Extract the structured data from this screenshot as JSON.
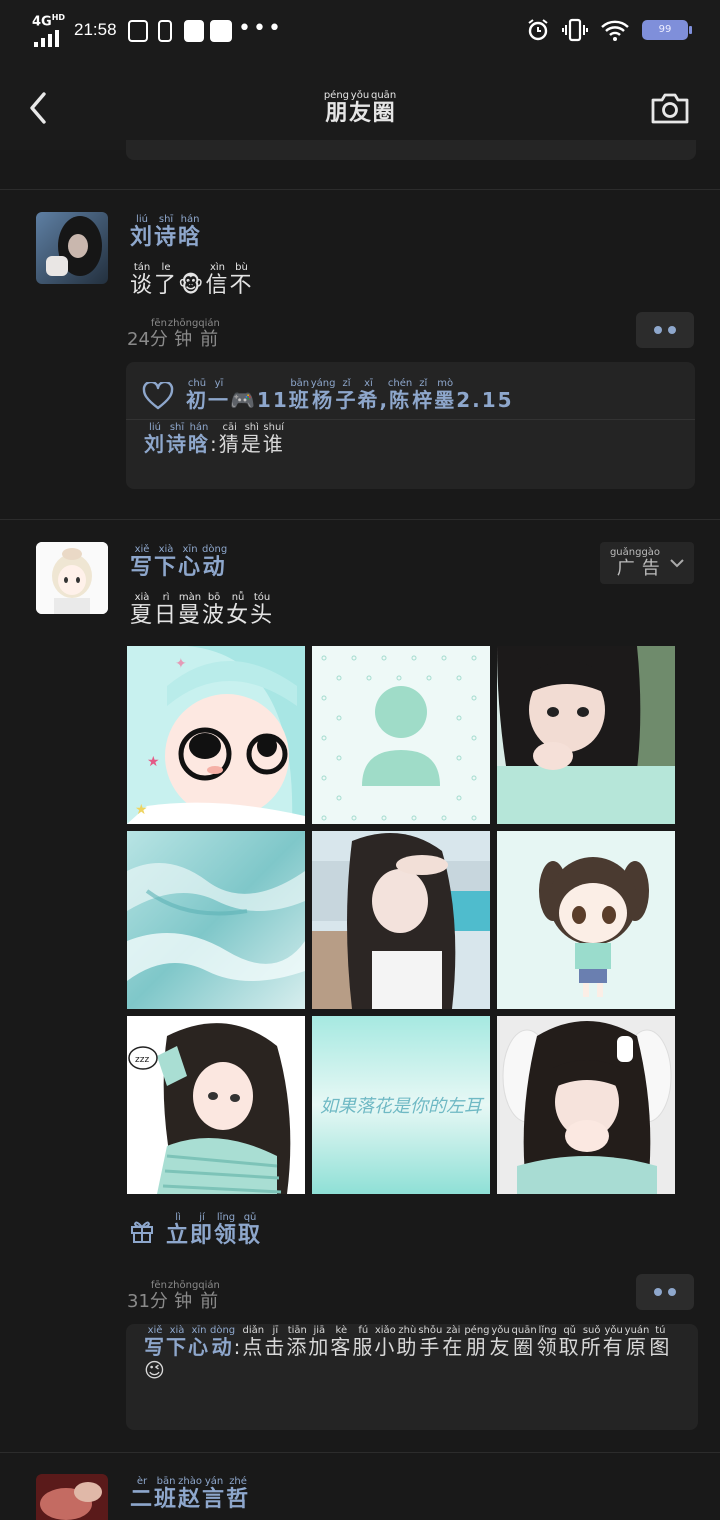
{
  "status_bar": {
    "network": "4G",
    "network_sup": "HD",
    "time": "21:58",
    "battery_label": "99",
    "accent_color": "#7f8fda"
  },
  "nav": {
    "title": [
      [
        "朋",
        "péng"
      ],
      [
        "友",
        "yǒu"
      ],
      [
        "圈",
        "quān"
      ]
    ],
    "back_icon": "chevron-left-icon",
    "camera_icon": "camera-icon"
  },
  "posts": [
    {
      "author": [
        [
          "刘",
          "liú"
        ],
        [
          "诗",
          "shī"
        ],
        [
          "晗",
          "hán"
        ]
      ],
      "text": [
        [
          "谈",
          "tán"
        ],
        [
          "了",
          "le"
        ],
        [
          "🐵",
          ""
        ],
        [
          "信",
          "xìn"
        ],
        [
          "不",
          "bù"
        ]
      ],
      "time_num": "24",
      "time_text": [
        [
          "分",
          "fēn"
        ],
        [
          "钟",
          "zhōng"
        ],
        [
          "前",
          "qián"
        ]
      ],
      "likes": {
        "names": [
          [
            "初",
            "chū"
          ],
          [
            "一",
            "yī"
          ],
          [
            "🎮",
            ""
          ],
          [
            "11",
            ""
          ],
          [
            "班",
            "bān"
          ],
          [
            "杨",
            "yáng"
          ],
          [
            "子",
            "zǐ"
          ],
          [
            "希",
            "xī"
          ],
          [
            ",",
            ""
          ],
          [
            "陈",
            "chén"
          ],
          [
            "梓",
            "zǐ"
          ],
          [
            "墨",
            "mò"
          ],
          [
            "2.15",
            ""
          ]
        ]
      },
      "comment": {
        "who": [
          [
            "刘",
            "liú"
          ],
          [
            "诗",
            "shī"
          ],
          [
            "晗",
            "hán"
          ]
        ],
        "sep": ":",
        "what": [
          [
            "猜",
            "cāi"
          ],
          [
            "是",
            "shì"
          ],
          [
            "谁",
            "shuí"
          ]
        ]
      }
    },
    {
      "author": [
        [
          "写",
          "xiě"
        ],
        [
          "下",
          "xià"
        ],
        [
          "心",
          "xīn"
        ],
        [
          "动",
          "dòng"
        ]
      ],
      "ad_label": [
        [
          "广",
          "guǎng"
        ],
        [
          "告",
          "gào"
        ]
      ],
      "text": [
        [
          "夏",
          "xià"
        ],
        [
          "日",
          "rì"
        ],
        [
          "曼",
          "màn"
        ],
        [
          "波",
          "bō"
        ],
        [
          "女",
          "nǚ"
        ],
        [
          "头",
          "tóu"
        ]
      ],
      "images": [
        "cartoon-girl-glasses",
        "default-avatar",
        "girl-photo-1",
        "ocean-waves",
        "girl-photo-beach",
        "chibi-girl",
        "anime-girl-striped",
        "mint-gradient-text",
        "girl-photo-bunny"
      ],
      "gradient_caption": "如果落花是你的左耳",
      "claim_label": [
        [
          "立",
          "lì"
        ],
        [
          "即",
          "jí"
        ],
        [
          "领",
          "lǐng"
        ],
        [
          "取",
          "qǔ"
        ]
      ],
      "time_num": "31",
      "time_text": [
        [
          "分",
          "fēn"
        ],
        [
          "钟",
          "zhōng"
        ],
        [
          "前",
          "qián"
        ]
      ],
      "comment": {
        "who": [
          [
            "写",
            "xiě"
          ],
          [
            "下",
            "xià"
          ],
          [
            "心",
            "xīn"
          ],
          [
            "动",
            "dòng"
          ]
        ],
        "sep": ":",
        "what": [
          [
            "点",
            "diǎn"
          ],
          [
            "击",
            "jī"
          ],
          [
            "添",
            "tiān"
          ],
          [
            "加",
            "jiā"
          ],
          [
            "客",
            "kè"
          ],
          [
            "服",
            "fú"
          ],
          [
            "小",
            "xiǎo"
          ],
          [
            "助",
            "zhù"
          ],
          [
            "手",
            "shǒu"
          ],
          [
            "在",
            "zài"
          ],
          [
            "朋",
            "péng"
          ],
          [
            "友",
            "yǒu"
          ],
          [
            "圈",
            "quān"
          ],
          [
            "领",
            "lǐng"
          ],
          [
            "取",
            "qǔ"
          ],
          [
            "所",
            "suǒ"
          ],
          [
            "有",
            "yǒu"
          ],
          [
            "原",
            "yuán"
          ],
          [
            "图",
            "tú"
          ],
          [
            "😉",
            ""
          ]
        ]
      }
    },
    {
      "author": [
        [
          "二",
          "èr"
        ],
        [
          "班",
          "bān"
        ],
        [
          "赵",
          "zhào"
        ],
        [
          "言",
          "yán"
        ],
        [
          "哲",
          "zhé"
        ]
      ]
    }
  ]
}
